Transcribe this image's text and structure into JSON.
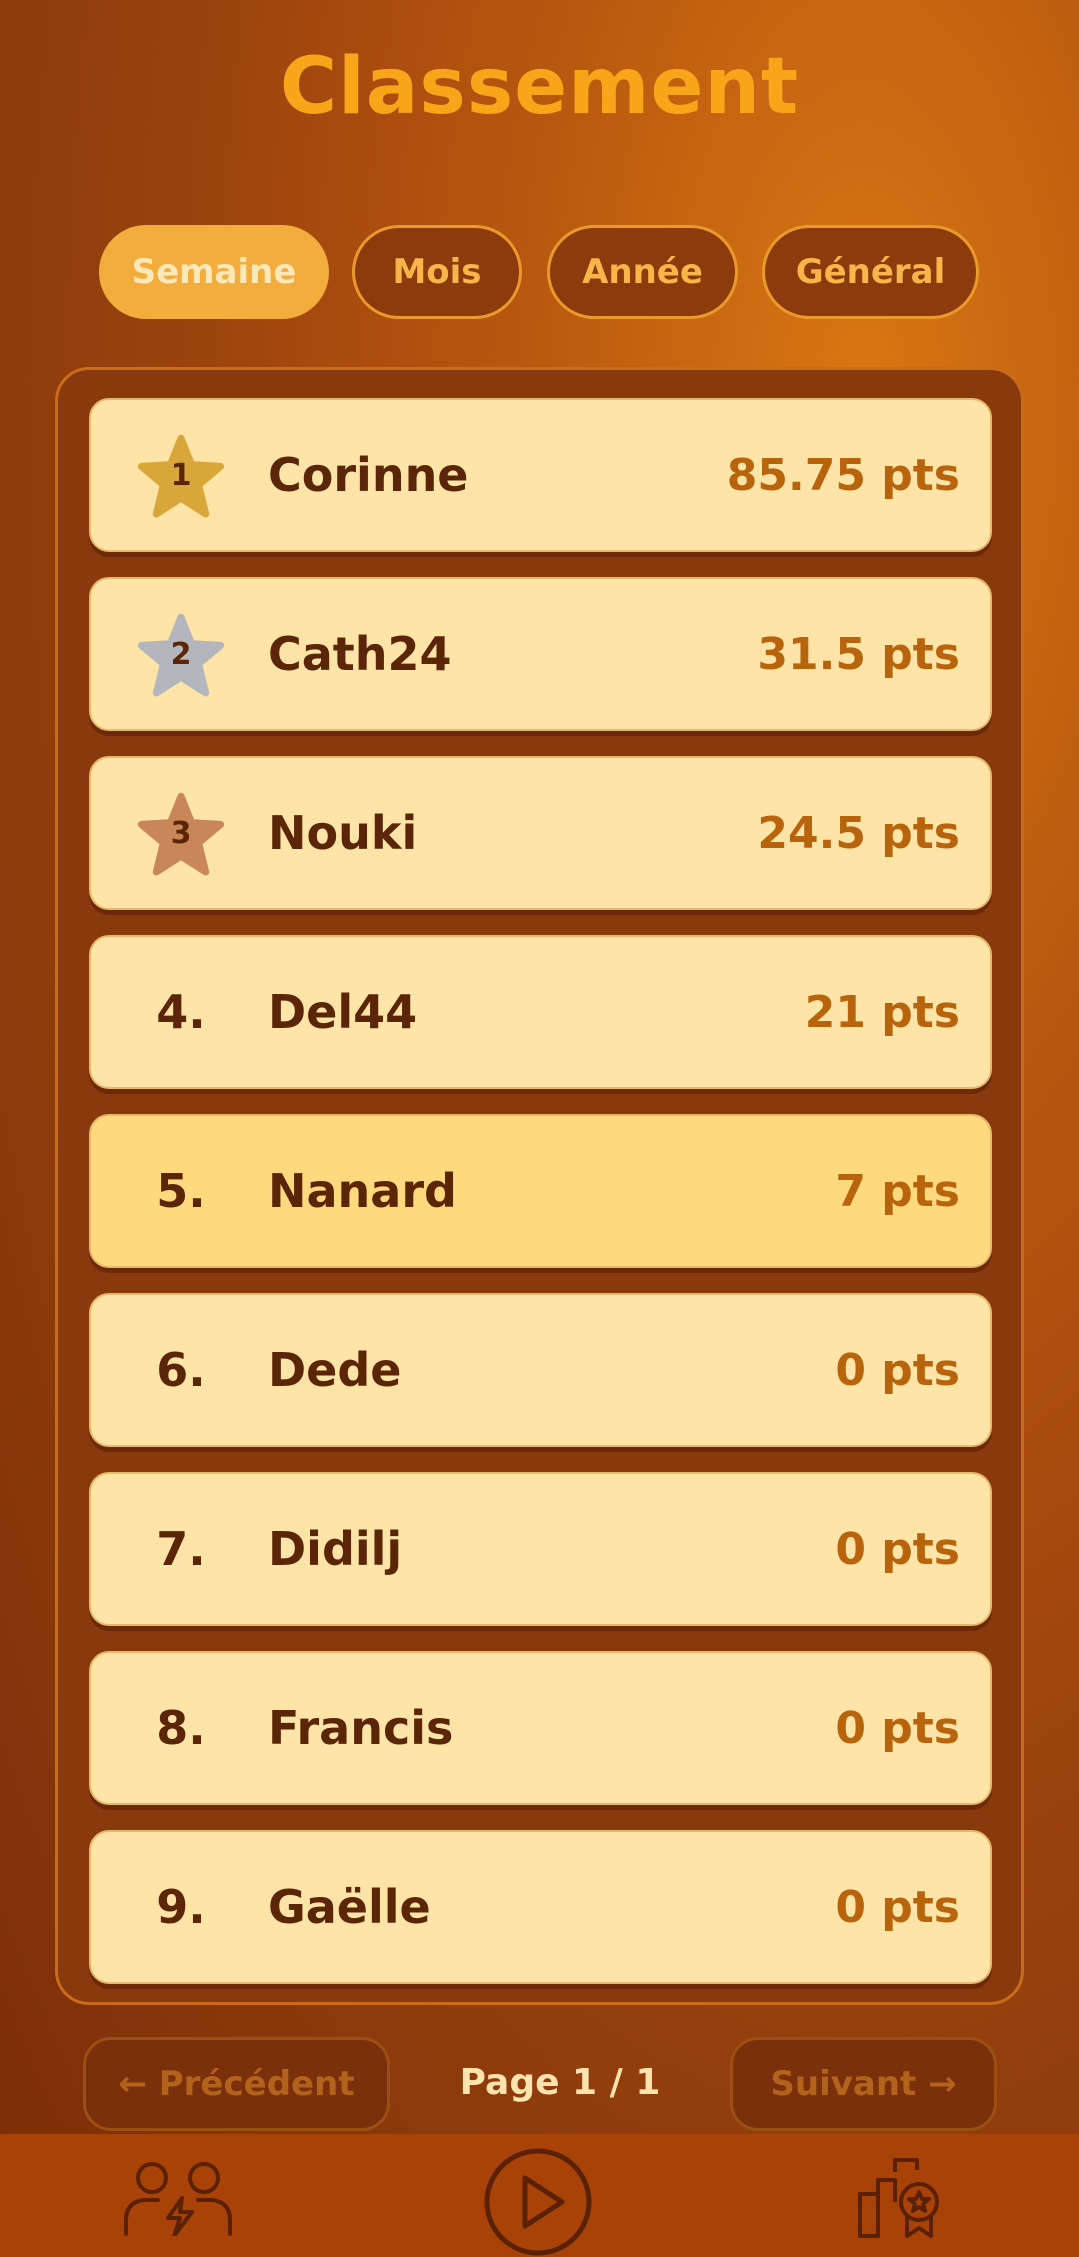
{
  "title": "Classement",
  "tabs": [
    {
      "label": "Semaine",
      "active": true
    },
    {
      "label": "Mois",
      "active": false
    },
    {
      "label": "Année",
      "active": false
    },
    {
      "label": "Général",
      "active": false
    }
  ],
  "leaderboard": [
    {
      "rank": "1",
      "badge": "gold-star",
      "name": "Corinne",
      "points": "85.75 pts"
    },
    {
      "rank": "2",
      "badge": "silver-star",
      "name": "Cath24",
      "points": "31.5 pts"
    },
    {
      "rank": "3",
      "badge": "bronze-star",
      "name": "Nouki",
      "points": "24.5 pts"
    },
    {
      "rank": "4.",
      "name": "Del44",
      "points": "21 pts"
    },
    {
      "rank": "5.",
      "name": "Nanard",
      "points": "7 pts",
      "highlighted": true
    },
    {
      "rank": "6.",
      "name": "Dede",
      "points": "0 pts"
    },
    {
      "rank": "7.",
      "name": "Didilj",
      "points": "0 pts"
    },
    {
      "rank": "8.",
      "name": "Francis",
      "points": "0 pts"
    },
    {
      "rank": "9.",
      "name": "Gaëlle",
      "points": "0 pts"
    }
  ],
  "pagination": {
    "prev_label": "← Précédent",
    "next_label": "Suivant →",
    "page_info": "Page 1 / 1"
  },
  "bottom_nav": {
    "items": [
      {
        "icon": "versus-users-icon"
      },
      {
        "icon": "play-icon"
      },
      {
        "icon": "leaderboard-icon"
      }
    ]
  },
  "colors": {
    "gold": "#d9a63a",
    "silver": "#b4b6bd",
    "bronze": "#c98658",
    "accent": "#f8a51a",
    "text_dark": "#5b2508"
  }
}
